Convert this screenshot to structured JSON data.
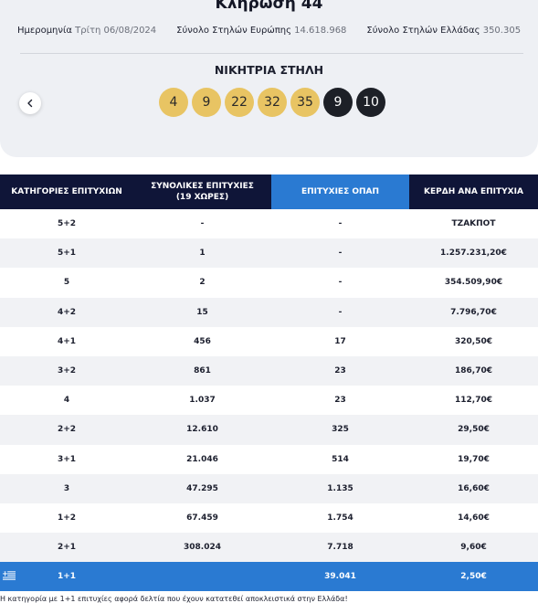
{
  "header": {
    "draw_title": "Κλήρωση 44",
    "date_label": "Ημερομηνία",
    "date_value": "Τρίτη 06/08/2024",
    "europe_label": "Σύνολο Στηλών Ευρώπης",
    "europe_value": "14.618.968",
    "greece_label": "Σύνολο Στηλών Ελλάδας",
    "greece_value": "350.305"
  },
  "winning_column": {
    "label": "ΝΙΚΗΤΡΙΑ ΣΤΗΛΗ",
    "main_numbers": [
      "4",
      "9",
      "22",
      "32",
      "35"
    ],
    "euro_numbers": [
      "9",
      "10"
    ],
    "colors": {
      "main": "#e8c463",
      "euro": "#1d2027"
    }
  },
  "table": {
    "headers": {
      "category": "ΚΑΤΗΓΟΡΙΕΣ ΕΠΙΤΥΧΙΩΝ",
      "total_line1": "ΣΥΝΟΛΙΚΕΣ ΕΠΙΤΥΧΙΕΣ",
      "total_line2": "(19 ΧΩΡΕΣ)",
      "opap": "ΕΠΙΤΥΧΙΕΣ ΟΠΑΠ",
      "prize": "ΚΕΡΔΗ ΑΝΑ ΕΠΙΤΥΧΙΑ"
    },
    "rows": [
      {
        "category": "5+2",
        "total": "-",
        "opap": "-",
        "prize": "ΤΖΑΚΠΟΤ"
      },
      {
        "category": "5+1",
        "total": "1",
        "opap": "-",
        "prize": "1.257.231,20€"
      },
      {
        "category": "5",
        "total": "2",
        "opap": "-",
        "prize": "354.509,90€"
      },
      {
        "category": "4+2",
        "total": "15",
        "opap": "-",
        "prize": "7.796,70€"
      },
      {
        "category": "4+1",
        "total": "456",
        "opap": "17",
        "prize": "320,50€"
      },
      {
        "category": "3+2",
        "total": "861",
        "opap": "23",
        "prize": "186,70€"
      },
      {
        "category": "4",
        "total": "1.037",
        "opap": "23",
        "prize": "112,70€"
      },
      {
        "category": "2+2",
        "total": "12.610",
        "opap": "325",
        "prize": "29,50€"
      },
      {
        "category": "3+1",
        "total": "21.046",
        "opap": "514",
        "prize": "19,70€"
      },
      {
        "category": "3",
        "total": "47.295",
        "opap": "1.135",
        "prize": "16,60€"
      },
      {
        "category": "1+2",
        "total": "67.459",
        "opap": "1.754",
        "prize": "14,60€"
      },
      {
        "category": "2+1",
        "total": "308.024",
        "opap": "7.718",
        "prize": "9,60€"
      },
      {
        "category": "1+1",
        "total": "",
        "opap": "39.041",
        "prize": "2,50€"
      }
    ],
    "colors": {
      "header": "#0f1538",
      "highlight": "#2a7ad2"
    }
  },
  "footnote": "Η κατηγορία με 1+1 επιτυχίες αφορά δελτία που έχουν κατατεθεί αποκλειστικά στην Ελλάδα!"
}
